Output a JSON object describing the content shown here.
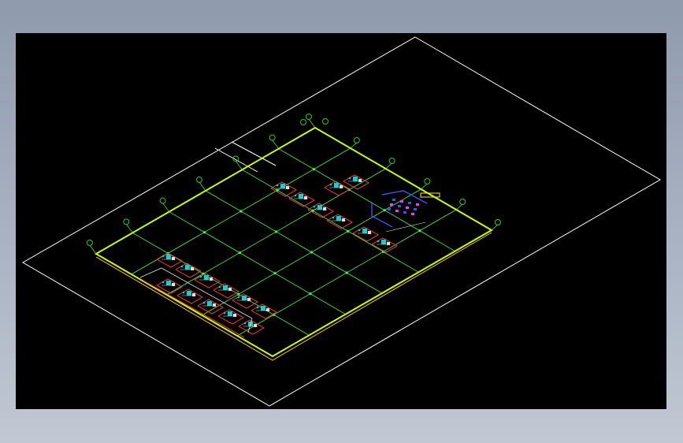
{
  "viewport": {
    "background": "#000000"
  },
  "colors": {
    "sheet_border": "#ffffff",
    "grid_lines": "#3fff3f",
    "slab_outline": "#ccff00",
    "wall_outline": "#ffcc00",
    "grid_bubble": "#22cc22",
    "equipment_cyan": "#00d4d4",
    "equipment_red": "#ff3b3b",
    "equipment_white": "#e0e0e0",
    "equipment_blue": "#3355ff",
    "equipment_magenta": "#ff33ff",
    "equipment_yellow": "#ffee00"
  },
  "drawing": {
    "view": "isometric",
    "grid_rows": 5,
    "grid_cols": 6,
    "equipment_units_row_a": 6,
    "equipment_units_row_b": 5,
    "equipment_units_upper": 8
  }
}
